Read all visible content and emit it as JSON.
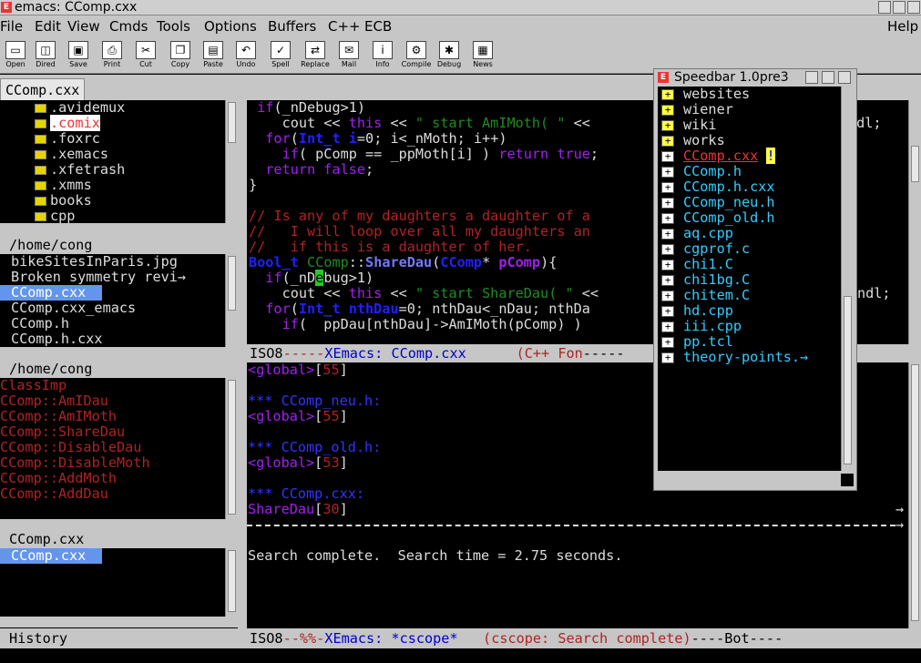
{
  "window": {
    "title": "emacs: CComp.cxx",
    "help_label": "Help"
  },
  "menubar": [
    "File",
    "Edit",
    "View",
    "Cmds",
    "Tools",
    "Options",
    "Buffers",
    "C++",
    "ECB"
  ],
  "toolbar": [
    "Open",
    "Dired",
    "Save",
    "Print",
    "Cut",
    "Copy",
    "Paste",
    "Undo",
    "Spell",
    "Replace",
    "Mail",
    "Info",
    "Compile",
    "Debug",
    "News"
  ],
  "tab": {
    "label": "CComp.cxx"
  },
  "dir_tree": {
    "items": [
      ".avidemux",
      ".comix",
      ".foxrc",
      ".xemacs",
      ".xfetrash",
      ".xmms",
      "books",
      "cpp"
    ],
    "selected": ".comix"
  },
  "sources": {
    "header": "/home/cong",
    "items": [
      "bikeSitesInParis.jpg",
      "Broken symmetry revi→",
      "CComp.cxx",
      "CComp.cxx_emacs",
      "CComp.h",
      "CComp.h.cxx"
    ],
    "selected": "CComp.cxx"
  },
  "methods": {
    "header": "/home/cong",
    "items": [
      "ClassImp",
      "CComp::AmIDau",
      "CComp::AmIMoth",
      "CComp::ShareDau",
      "CComp::DisableDau",
      "CComp::DisableMoth",
      "CComp::AddMoth",
      "CComp::AddDau"
    ]
  },
  "history": {
    "header": "CComp.cxx",
    "items": [
      "CComp.cxx"
    ],
    "footer": "History"
  },
  "editor": {
    "lines": [
      " if(_nDebug>1)",
      "    cout << this << \" start AmIMoth( \" <<",
      "  for(Int_t i=0; i<_nMoth; i++)",
      "    if( pComp == _ppMoth[i] ) return true;",
      "  return false;",
      "}",
      "",
      "// Is any of my daughters a daughter of a",
      "//   I will loop over all my daughters an",
      "//   if this is a daughter of her.",
      "Bool_t CComp::ShareDau(CComp* pComp){",
      "  if(_nDebug>1)",
      "    cout << this << \" start ShareDau( \" <<",
      "  for(Int_t nthDau=0; nthDau<_nDau; nthDa",
      "    if(  ppDau[nthDau]->AmIMoth(pComp) )"
    ],
    "right_col_1": "ndl;",
    "right_col_2": "ndl;",
    "modeline": {
      "coding": "ISO8",
      "dashes": "-----",
      "buffer": "XEmacs: CComp.cxx",
      "mode": "(C++ Fon",
      "tail": "-----"
    }
  },
  "cscope": {
    "lines": [
      {
        "kind": "ref",
        "a": "<global>",
        "b": "55",
        "pre": "",
        "post": ""
      },
      {
        "kind": "blank"
      },
      {
        "kind": "file",
        "text": "*** CComp_neu.h:"
      },
      {
        "kind": "ref",
        "a": "<global>",
        "b": "55"
      },
      {
        "kind": "blank"
      },
      {
        "kind": "file",
        "text": "*** CComp_old.h:"
      },
      {
        "kind": "ref",
        "a": "<global>",
        "b": "53"
      },
      {
        "kind": "blank"
      },
      {
        "kind": "file",
        "text": "*** CComp.cxx:"
      },
      {
        "kind": "ref",
        "a": "ShareDau",
        "b": "30"
      }
    ],
    "status": "Search complete.  Search time = 2.75 seconds.",
    "modeline": {
      "coding": "ISO8",
      "flags": "--%%-",
      "buffer": "XEmacs: *cscope*",
      "mode": "(cscope: Search complete)",
      "tail": "----Bot----"
    }
  },
  "speedbar": {
    "title": "Speedbar 1.0pre3",
    "folders": [
      "websites",
      "wiener",
      "wiki",
      "works"
    ],
    "files": [
      "CComp.cxx",
      "CComp.h",
      "CComp.h.cxx",
      "CComp_neu.h",
      "CComp_old.h",
      "aq.cpp",
      "cgprof.c",
      "chi1.C",
      "chi1bg.C",
      "chitem.C",
      "hd.cpp",
      "iii.cpp",
      "pp.tcl",
      "theory-points.→"
    ],
    "current": "CComp.cxx",
    "current_marker": "!"
  },
  "colors": {
    "source_blue": "#7777ff",
    "method_red": "#b22222",
    "cscope_file": "#3333ff",
    "cscope_global": "#a020f0",
    "cscope_num": "#b22222",
    "speedbar_file": "#33ccff"
  }
}
